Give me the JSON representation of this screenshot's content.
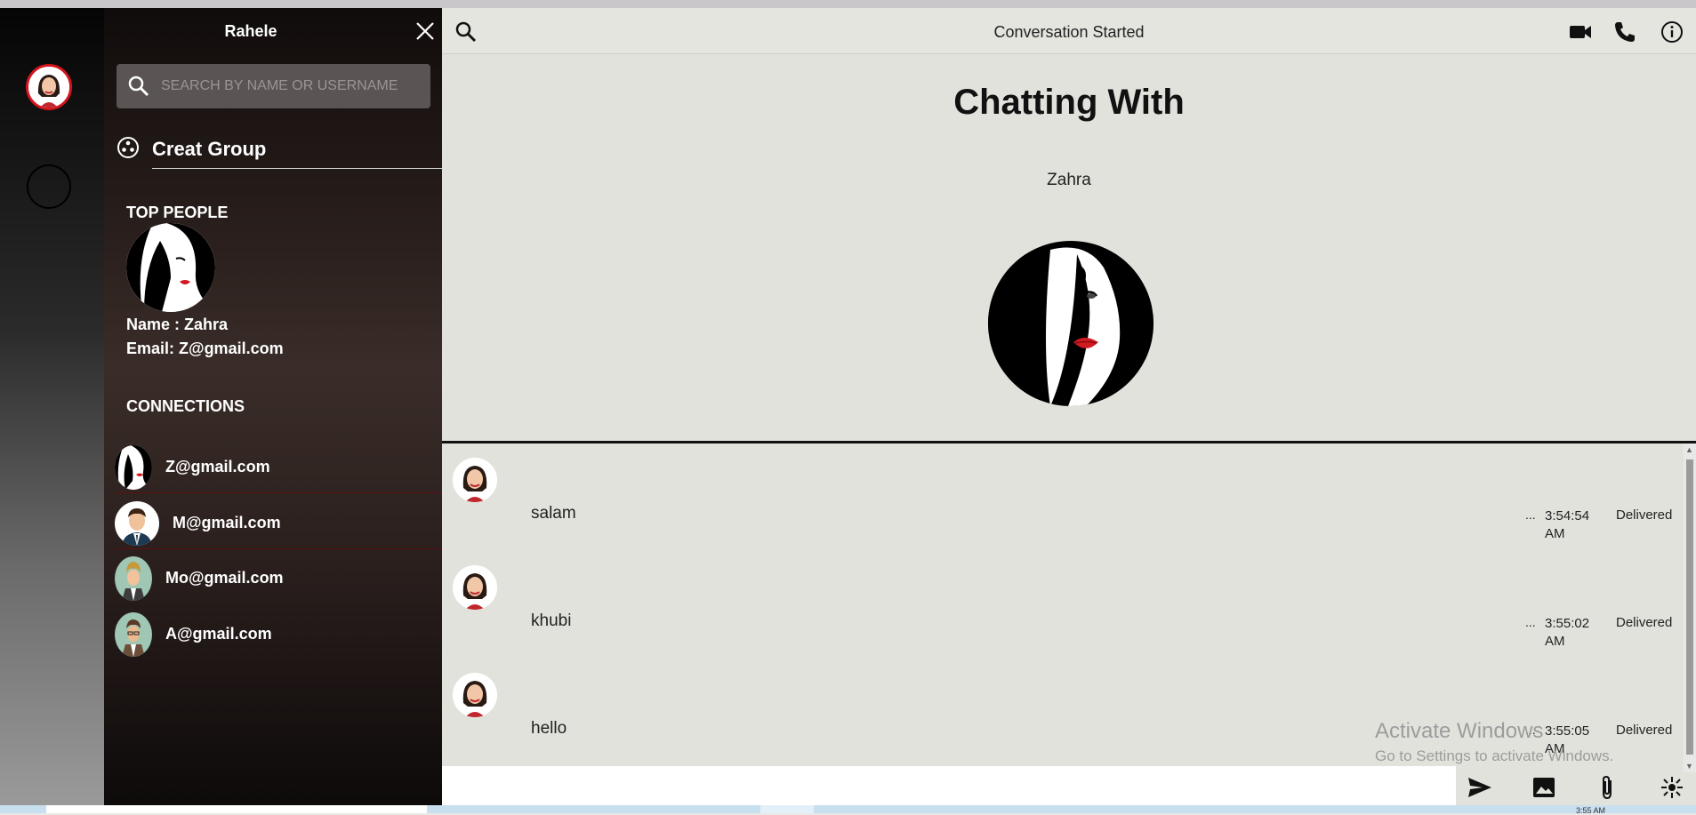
{
  "sidebar": {
    "title": "Rahele",
    "search_placeholder": "SEARCH BY NAME OR USERNAME",
    "create_group_label": "Creat Group",
    "top_people_heading": "TOP PEOPLE",
    "top_person": {
      "name": "Name : Zahra",
      "email": "Email: Z@gmail.com"
    },
    "connections_heading": "CONNECTIONS",
    "connections": [
      {
        "email": "Z@gmail.com",
        "avatar": "woman-illustration"
      },
      {
        "email": "M@gmail.com",
        "avatar": "man-suit"
      },
      {
        "email": "Mo@gmail.com",
        "avatar": "man-green"
      },
      {
        "email": "A@gmail.com",
        "avatar": "man-green-glasses"
      }
    ]
  },
  "header": {
    "title": "Conversation Started",
    "icons": [
      "search-icon",
      "video-icon",
      "phone-icon",
      "info-icon"
    ]
  },
  "partner": {
    "heading": "Chatting With",
    "name": "Zahra"
  },
  "messages": [
    {
      "text": "salam",
      "more": "...",
      "time": "3:54:54 AM",
      "status": "Delivered"
    },
    {
      "text": "khubi",
      "more": "...",
      "time": "3:55:02 AM",
      "status": "Delivered"
    },
    {
      "text": "hello",
      "more": "...",
      "time": "3:55:05 AM",
      "status": "Delivered"
    }
  ],
  "composer": {
    "value": "",
    "icons": [
      "send-icon",
      "image-icon",
      "attach-icon",
      "emoji-icon"
    ]
  },
  "watermark": {
    "line1": "Activate Windows",
    "line2": "Go to Settings to activate Windows."
  },
  "taskbar": {
    "time": "3:55 AM"
  },
  "colors": {
    "accent_red": "#d4141c",
    "chat_bg": "#e2e2dd",
    "sidebar_dark": "#2b201d"
  }
}
